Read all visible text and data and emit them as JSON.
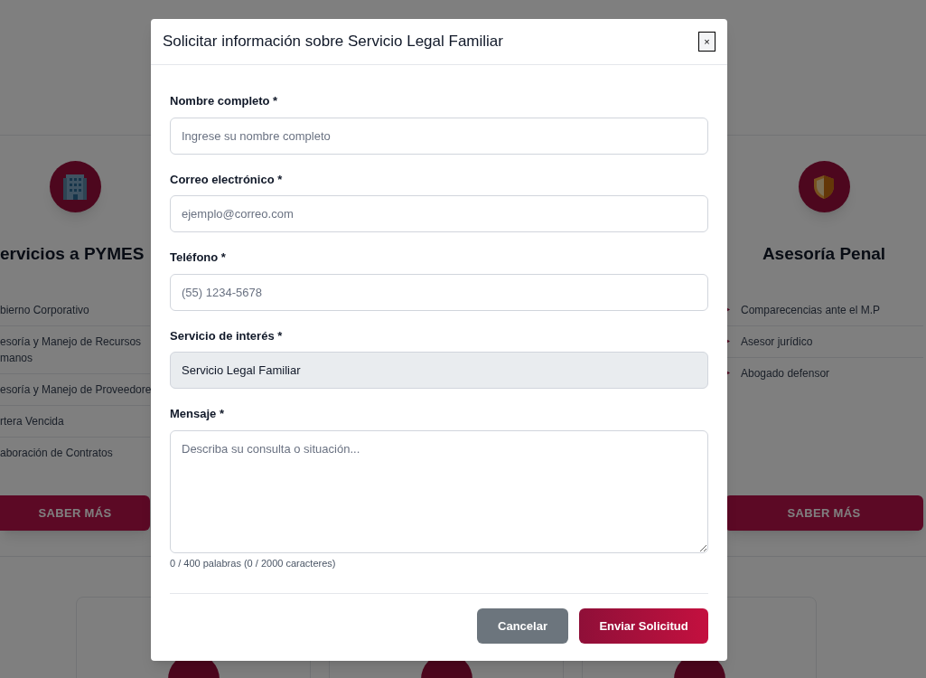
{
  "background_page": {
    "service_cards": [
      {
        "title": "ervicios a PYMES",
        "items": [
          "bierno Corporativo",
          "esoría y Manejo de Recursos manos",
          "esoría y Manejo de Proveedore",
          "rtera Vencida",
          "aboración de Contratos"
        ],
        "button": "SABER MÁS"
      },
      {
        "title": "Asesoría Penal",
        "items": [
          "Comparecencias ante el M.P",
          "Asesor jurídico",
          "Abogado defensor"
        ],
        "button": "SABER MÁS"
      }
    ]
  },
  "modal": {
    "title": "Solicitar información sobre Servicio Legal Familiar",
    "close": "×",
    "fields": [
      {
        "label": "Nombre completo *",
        "kind": "input",
        "placeholder": "Ingrese su nombre completo"
      },
      {
        "label": "Correo electrónico *",
        "kind": "input",
        "placeholder": "ejemplo@correo.com"
      },
      {
        "label": "Teléfono *",
        "kind": "input",
        "placeholder": "(55) 1234-5678"
      },
      {
        "label": "Servicio de interés *",
        "kind": "readonly",
        "value": "Servicio Legal Familiar"
      },
      {
        "label": "Mensaje *",
        "kind": "textarea",
        "placeholder": "Describa su consulta o situación..."
      }
    ],
    "counter": "0 / 400 palabras (0 / 2000 caracteres)",
    "buttons": [
      {
        "label": "Cancelar",
        "kind": "secondary"
      },
      {
        "label": "Enviar Solicitud",
        "kind": "primary"
      }
    ]
  }
}
